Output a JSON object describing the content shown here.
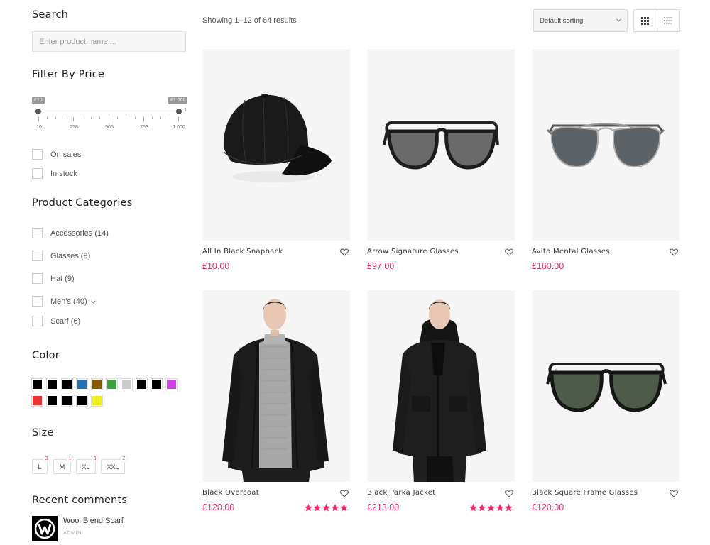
{
  "search": {
    "title": "Search",
    "placeholder": "Enter product name ..."
  },
  "price_filter": {
    "title": "Filter By Price",
    "min_label": "£10",
    "max_label": "£1 000",
    "end_marker": "1",
    "ticks": [
      "10",
      "258",
      "505",
      "753",
      "1 000"
    ]
  },
  "stock_filters": [
    {
      "label": "On sales"
    },
    {
      "label": "In stock"
    }
  ],
  "categories": {
    "title": "Product Categories",
    "items": [
      {
        "label": "Accessories (14)"
      },
      {
        "label": "Glasses (9)"
      },
      {
        "label": "Hat (9)"
      },
      {
        "label": "Men's (40)",
        "expandable": true
      },
      {
        "label": "Scarf (6)"
      }
    ]
  },
  "colors": {
    "title": "Color",
    "swatches": [
      "#000000",
      "#000000",
      "#000000",
      "#1e73be",
      "#8a5a00",
      "#3aa33a",
      "#cccccc",
      "#000000",
      "#000000",
      "#d23ee8",
      "#ee3333",
      "#000000",
      "#000000",
      "#000000",
      "#eeee22"
    ]
  },
  "sizes": {
    "title": "Size",
    "items": [
      {
        "label": "L",
        "count": "3"
      },
      {
        "label": "M",
        "count": "1"
      },
      {
        "label": "XL",
        "count": "3"
      },
      {
        "label": "XXL",
        "count": "2"
      }
    ]
  },
  "recent_comments": {
    "title": "Recent comments",
    "items": [
      {
        "title": "Wool Blend Scarf",
        "author": "ADMIN"
      }
    ]
  },
  "toolbar": {
    "results_text": "Showing 1–12 of 64 results",
    "sort_value": "Default sorting",
    "view_mode": "grid"
  },
  "products": [
    {
      "name": "All In Black Snapback",
      "price": "£10.00",
      "image": "cap",
      "rating": 0
    },
    {
      "name": "Arrow Signature Glasses",
      "price": "£97.00",
      "image": "sunglasses-gray",
      "rating": 0
    },
    {
      "name": "Avito Mental Glasses",
      "price": "£160.00",
      "image": "aviator-glasses",
      "rating": 0
    },
    {
      "name": "Black Overcoat",
      "price": "£120.00",
      "image": "model-overcoat",
      "rating": 5
    },
    {
      "name": "Black Parka Jacket",
      "price": "£213.00",
      "image": "model-parka",
      "rating": 5
    },
    {
      "name": "Black Square Frame Glasses",
      "price": "£120.00",
      "image": "sunglasses-green",
      "rating": 0
    }
  ],
  "accent_color": "#e5336c"
}
